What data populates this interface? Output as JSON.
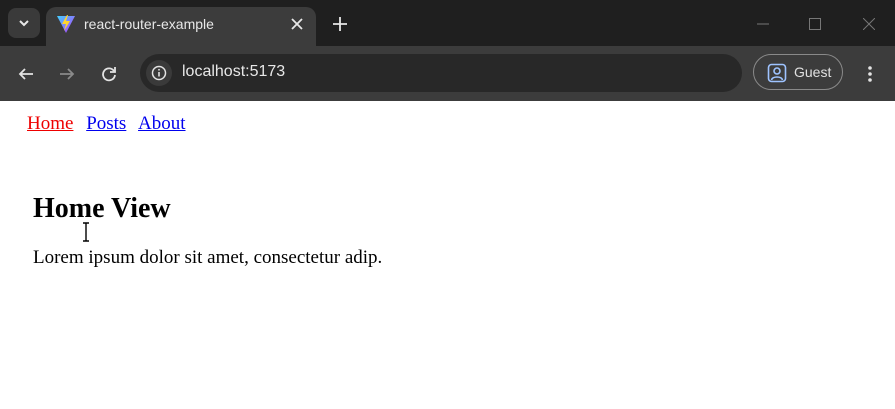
{
  "browser": {
    "tab": {
      "title": "react-router-example"
    },
    "address_bar": {
      "url": "localhost:5173"
    },
    "profile": {
      "label": "Guest"
    },
    "icons": {
      "tab_search": "chevron-down-icon",
      "favicon": "vite-logo-icon",
      "tab_close": "close-icon",
      "new_tab": "plus-icon",
      "minimize": "minimize-icon",
      "maximize": "maximize-icon",
      "close_window": "close-icon",
      "back": "arrow-left-icon",
      "forward": "arrow-right-icon",
      "reload": "reload-icon",
      "site_info": "info-icon",
      "profile": "person-icon",
      "menu": "more-vert-icon"
    },
    "colors": {
      "titlebar": "#1f1f1f",
      "toolbar": "#3c3c3c",
      "omnibox": "#282828"
    }
  },
  "page": {
    "nav": [
      {
        "label": "Home",
        "active": true
      },
      {
        "label": "Posts",
        "active": false
      },
      {
        "label": "About",
        "active": false
      }
    ],
    "title": "Home View",
    "body": "Lorem ipsum dolor sit amet, consectetur adip.",
    "colors": {
      "link": "#0000ee",
      "active_link": "#ee0000"
    }
  }
}
